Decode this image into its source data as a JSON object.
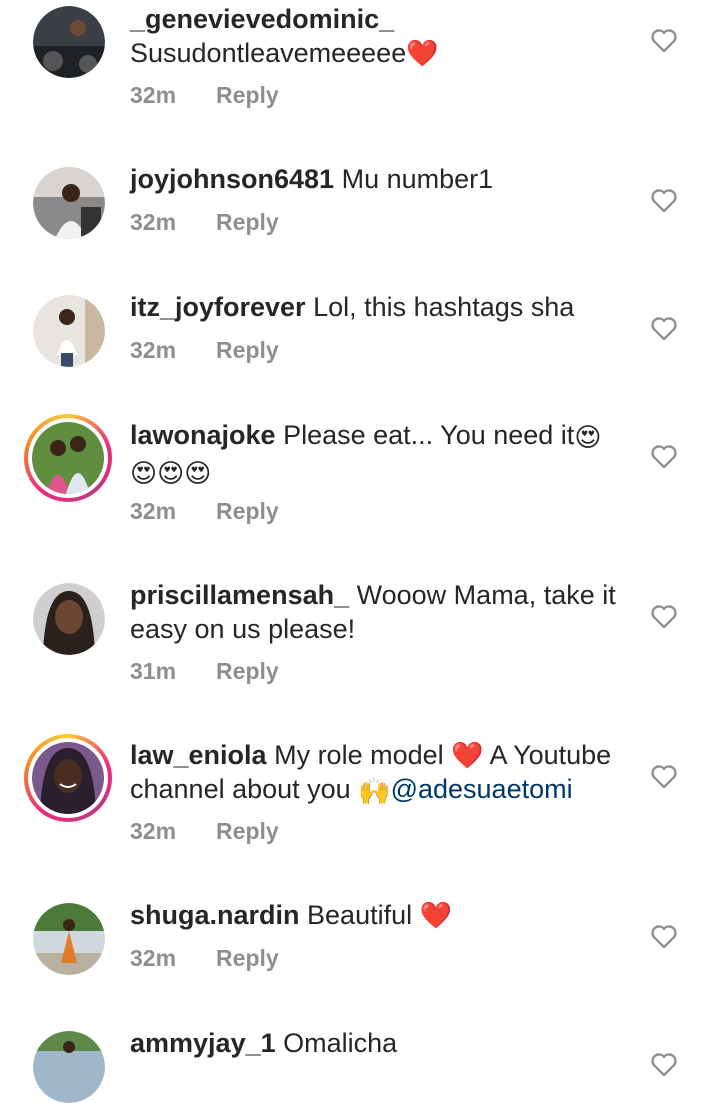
{
  "comments": [
    {
      "username": "_genevievedominic_",
      "text": "Susudontleavemeeeee",
      "emoji_after": "❤️",
      "time": "32m",
      "reply": "Reply"
    },
    {
      "username": "joyjohnson6481",
      "text": "Mu number1",
      "time": "32m",
      "reply": "Reply"
    },
    {
      "username": "itz_joyforever",
      "text": "Lol, this hashtags sha",
      "time": "32m",
      "reply": "Reply"
    },
    {
      "username": "lawonajoke",
      "text": "Please eat... You need it",
      "emoji_after": "😍",
      "emoji_line2": "😍😍😍",
      "time": "32m",
      "reply": "Reply"
    },
    {
      "username": "priscillamensah_",
      "text": "Wooow Mama, take it easy on us please!",
      "time": "31m",
      "reply": "Reply"
    },
    {
      "username": "law_eniola",
      "text_part1": "My role model",
      "emoji_mid": "❤️",
      "text_part2": "A Youtube channel about you",
      "emoji_hands": "🙌",
      "mention": "@adesuaetomi",
      "time": "32m",
      "reply": "Reply"
    },
    {
      "username": "shuga.nardin",
      "text": "Beautiful",
      "emoji_after": "❤️",
      "time": "32m",
      "reply": "Reply"
    },
    {
      "username": "ammyjay_1",
      "text": "Omalicha"
    }
  ],
  "colors": {
    "text": "#262626",
    "meta": "#8e8e8e",
    "mention": "#00376b",
    "heart": "#e0245e"
  },
  "icons": {
    "like": "heart-outline-icon"
  }
}
